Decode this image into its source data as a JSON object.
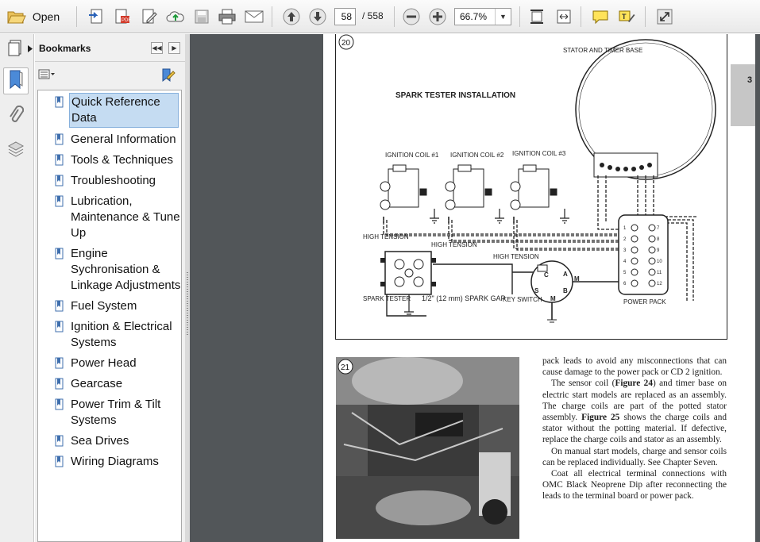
{
  "toolbar": {
    "open_label": "Open",
    "page_current": "58",
    "page_total": "/ 558",
    "zoom_value": "66.7%"
  },
  "bookmarks_panel": {
    "title": "Bookmarks",
    "items": [
      {
        "label": "Quick Reference Data",
        "selected": true
      },
      {
        "label": "General Information"
      },
      {
        "label": "Tools & Techniques"
      },
      {
        "label": "Troubleshooting"
      },
      {
        "label": "Lubrication, Maintenance & Tune Up"
      },
      {
        "label": "Engine Sychronisation & Linkage Adjustments"
      },
      {
        "label": "Fuel System"
      },
      {
        "label": "Ignition & Electrical Systems"
      },
      {
        "label": "Power Head"
      },
      {
        "label": "Gearcase"
      },
      {
        "label": "Power Trim & Tilt Systems"
      },
      {
        "label": "Sea Drives"
      },
      {
        "label": "Wiring Diagrams"
      }
    ]
  },
  "document": {
    "chapter_tab": "3",
    "figure20": {
      "number": "20",
      "title": "SPARK TESTER INSTALLATION",
      "stator_label": "STATOR AND TIMER BASE",
      "coil1": "IGNITION COIL #1",
      "coil2": "IGNITION COIL #2",
      "coil3": "IGNITION COIL #3",
      "ht1": "HIGH TENSION",
      "ht2": "HIGH TENSION",
      "ht3": "HIGH TENSION",
      "spark_tester": "SPARK TESTER",
      "spark_gap": "1/2\" (12 mm) SPARK GAP",
      "key_switch": "KEY SWITCH",
      "power_pack": "POWER PACK",
      "terminals_left": [
        "1",
        "2",
        "3",
        "4",
        "5",
        "6"
      ],
      "terminals_right": [
        "7",
        "8",
        "9",
        "10",
        "11",
        "12"
      ],
      "key_letters": [
        "A",
        "M",
        "C",
        "B",
        "S",
        "M"
      ]
    },
    "figure21": {
      "number": "21"
    },
    "text": {
      "p1": "pack leads to avoid any misconnections that can cause damage to the power pack or CD 2 ignition.",
      "p2_a": "The sensor coil (",
      "p2_fig24": "Figure 24",
      "p2_b": ") and timer base on electric start models are replaced as an assembly. The charge coils are part of the potted stator assembly. ",
      "p2_fig25": "Figure 25",
      "p2_c": " shows the charge coils and stator without the potting material. If defective, replace the charge coils and stator as an assembly.",
      "p3": "On manual start models, charge and sensor coils can be replaced individually. See Chapter Seven.",
      "p4": "Coat all electrical terminal connections with OMC Black Neoprene Dip after reconnecting the leads to the terminal board or power pack."
    }
  },
  "colors": {
    "toolbar_bg": "#eeeeee",
    "doc_background": "#525659",
    "selection_bg": "#c5dcf2",
    "panel_bg": "#f0f0f0"
  },
  "icons": [
    "folder-open-icon",
    "create-pdf-icon",
    "pdf-edit-icon",
    "sign-icon",
    "cloud-upload-icon",
    "save-icon",
    "print-icon",
    "email-icon",
    "prev-page-icon",
    "next-page-icon",
    "zoom-out-icon",
    "zoom-in-icon",
    "fit-page-icon",
    "fit-width-icon",
    "comment-icon",
    "highlight-icon",
    "expand-icon",
    "pages-icon",
    "bookmark-icon",
    "paperclip-icon",
    "layers-icon",
    "options-icon",
    "bookmark-add-icon"
  ]
}
